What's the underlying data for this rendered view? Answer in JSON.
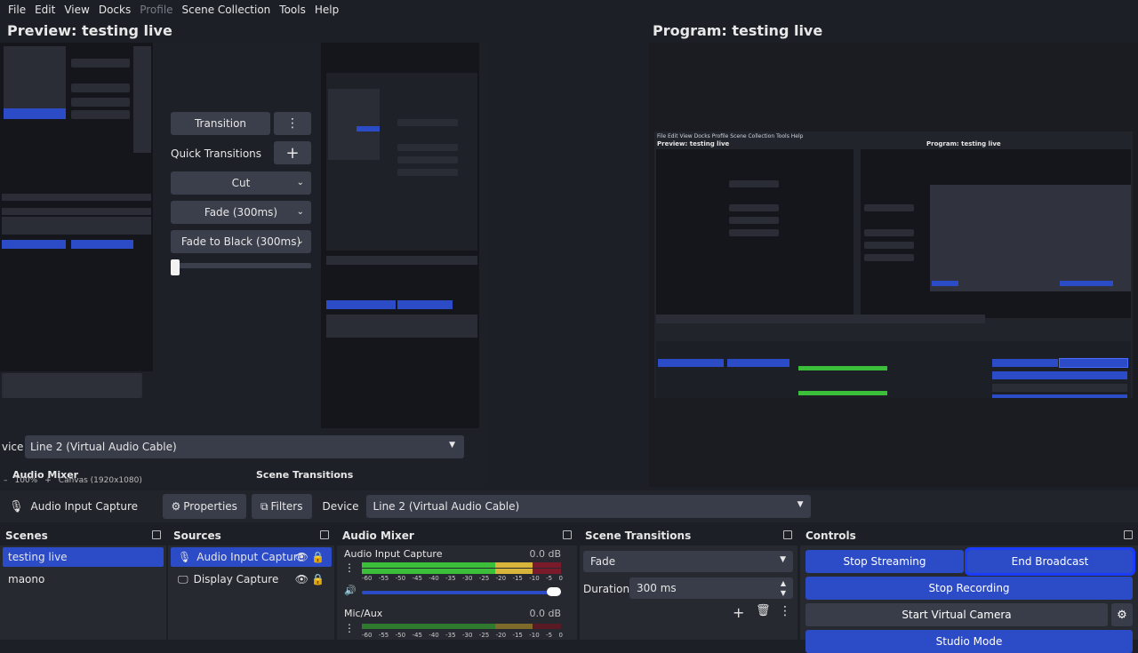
{
  "menu": [
    "File",
    "Edit",
    "View",
    "Docks",
    "Profile",
    "Scene Collection",
    "Tools",
    "Help"
  ],
  "preview": {
    "title": "Preview: testing live"
  },
  "program": {
    "title": "Program: testing live"
  },
  "quick_transitions": {
    "transition_label": "Transition",
    "quick_label": "Quick Transitions",
    "items": [
      "Cut",
      "Fade (300ms)",
      "Fade to Black (300ms)"
    ]
  },
  "preview_overlay": {
    "device_label": "vice",
    "device_value": "Line 2 (Virtual Audio Cable)",
    "audio_mixer": "Audio Mixer",
    "scene_transitions": "Scene Transitions",
    "zoom": "100%",
    "canvas": "Canvas (1920x1080)"
  },
  "source_toolbar": {
    "source_name": "Audio Input Capture",
    "properties": "Properties",
    "filters": "Filters",
    "device_label": "Device",
    "device_value": "Line 2 (Virtual Audio Cable)"
  },
  "scenes": {
    "title": "Scenes",
    "items": [
      "testing live",
      "maono"
    ]
  },
  "sources": {
    "title": "Sources",
    "items": [
      "Audio Input Capture",
      "Display Capture"
    ]
  },
  "audio_mixer": {
    "title": "Audio Mixer",
    "channels": [
      {
        "name": "Audio Input Capture",
        "level": "0.0 dB"
      },
      {
        "name": "Mic/Aux",
        "level": "0.0 dB"
      }
    ],
    "scale": [
      "-60",
      "-55",
      "-50",
      "-45",
      "-40",
      "-35",
      "-30",
      "-25",
      "-20",
      "-15",
      "-10",
      "-5",
      "0"
    ]
  },
  "scene_transitions": {
    "title": "Scene Transitions",
    "transition": "Fade",
    "duration_label": "Duration",
    "duration_value": "300 ms"
  },
  "controls": {
    "title": "Controls",
    "stop_streaming": "Stop Streaming",
    "end_broadcast": "End Broadcast",
    "stop_recording": "Stop Recording",
    "start_virtual_camera": "Start Virtual Camera",
    "studio_mode": "Studio Mode"
  },
  "colors": {
    "accent": "#2c4bc7",
    "highlight_border": "#1a3cff",
    "meter_green": "#3bbf3b",
    "meter_yellow": "#d9b43a",
    "meter_red": "#b3233a"
  }
}
